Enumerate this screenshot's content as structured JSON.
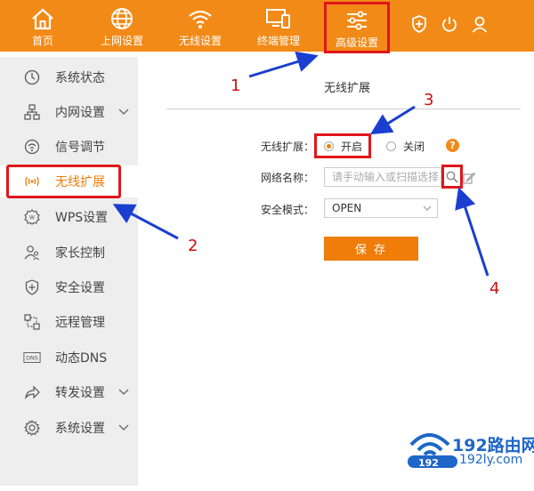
{
  "topnav": {
    "home": "首页",
    "internet": "上网设置",
    "wifi": "无线设置",
    "terminal": "终端管理",
    "advanced": "高级设置"
  },
  "sidebar": {
    "items": [
      {
        "label": "系统状态",
        "icon": "clock-icon"
      },
      {
        "label": "内网设置",
        "icon": "network-icon"
      },
      {
        "label": "信号调节",
        "icon": "signal-icon"
      },
      {
        "label": "无线扩展",
        "icon": "wireless-extend-icon"
      },
      {
        "label": "WPS设置",
        "icon": "wps-icon"
      },
      {
        "label": "家长控制",
        "icon": "parent-icon"
      },
      {
        "label": "安全设置",
        "icon": "shield-icon"
      },
      {
        "label": "远程管理",
        "icon": "remote-icon"
      },
      {
        "label": "动态DNS",
        "icon": "dns-icon"
      },
      {
        "label": "转发设置",
        "icon": "forward-icon"
      },
      {
        "label": "系统设置",
        "icon": "gear-icon"
      }
    ]
  },
  "main": {
    "title": "无线扩展",
    "extend_label": "无线扩展：",
    "option_on": "开启",
    "option_off": "关闭",
    "help": "?",
    "ssid_label": "网络名称：",
    "ssid_placeholder": "请手动输入或扫描选择",
    "security_label": "安全模式：",
    "security_value": "OPEN",
    "save": "保 存"
  },
  "annotations": {
    "n1": "1",
    "n2": "2",
    "n3": "3",
    "n4": "4"
  },
  "watermark": {
    "brand": "192路由网",
    "domain": "192ly.com",
    "badge": "192"
  },
  "colors": {
    "accent": "#f28a17",
    "highlight": "#e0161b",
    "arrow": "#1a3fd0"
  }
}
